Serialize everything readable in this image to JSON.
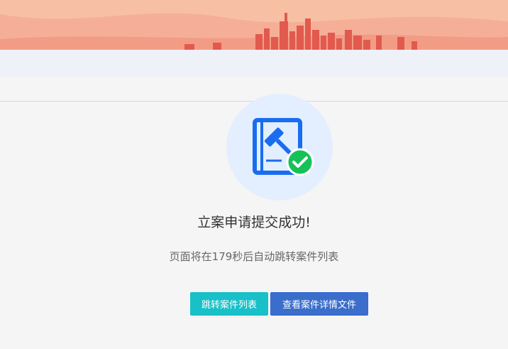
{
  "banner": {
    "colors": {
      "sky": "#f7b59a",
      "skyline": "#e25a4e"
    }
  },
  "result": {
    "icon": "judgment-document-check-icon",
    "title": "立案申请提交成功!",
    "countdown_text": "页面将在179秒后自动跳转案件列表"
  },
  "actions": {
    "go_list_label": "跳转案件列表",
    "view_detail_label": "查看案件详情文件"
  },
  "colors": {
    "accent_blue": "#1a6cf0",
    "success_green": "#16c257",
    "teal": "#18c0c8",
    "button_blue": "#3b6ecb"
  }
}
